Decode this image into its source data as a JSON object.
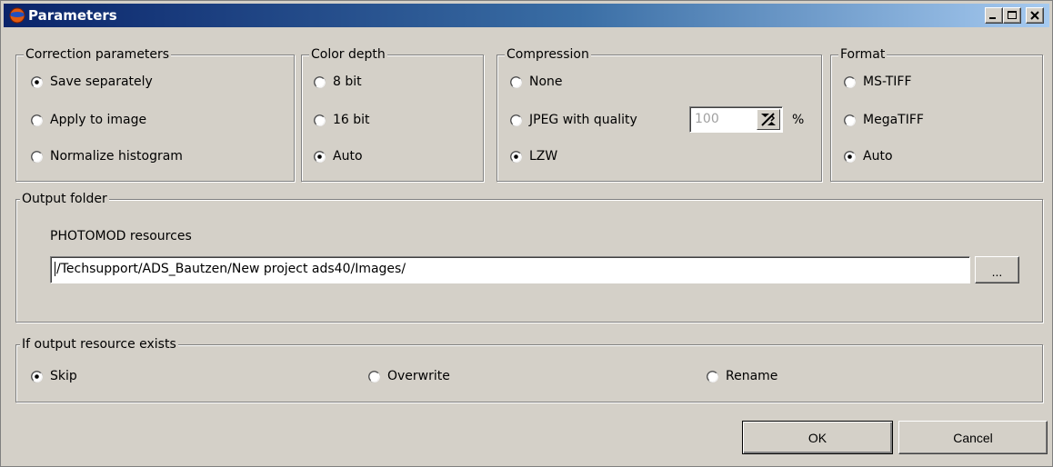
{
  "window": {
    "title": "Parameters"
  },
  "correction": {
    "title": "Correction parameters",
    "options": [
      "Save separately",
      "Apply to image",
      "Normalize histogram"
    ],
    "selected": 0
  },
  "color_depth": {
    "title": "Color depth",
    "options": [
      "8 bit",
      "16 bit",
      "Auto"
    ],
    "selected": 2
  },
  "compression": {
    "title": "Compression",
    "options": [
      "None",
      "JPEG with quality",
      "LZW"
    ],
    "selected": 2,
    "quality_value": "100",
    "quality_unit": "%"
  },
  "format": {
    "title": "Format",
    "options": [
      "MS-TIFF",
      "MegaTIFF",
      "Auto"
    ],
    "selected": 2
  },
  "output_folder": {
    "title": "Output folder",
    "resource_label": "PHOTOMOD resources",
    "path": "/Techsupport/ADS_Bautzen/New project ads40/Images/",
    "browse_label": "..."
  },
  "if_exists": {
    "title": "If output resource exists",
    "options": [
      "Skip",
      "Overwrite",
      "Rename"
    ],
    "selected": 0
  },
  "buttons": {
    "ok": "OK",
    "cancel": "Cancel"
  },
  "colors": {
    "face": "#d4d0c8",
    "title_start": "#0a246a",
    "title_end": "#a6caf0"
  }
}
